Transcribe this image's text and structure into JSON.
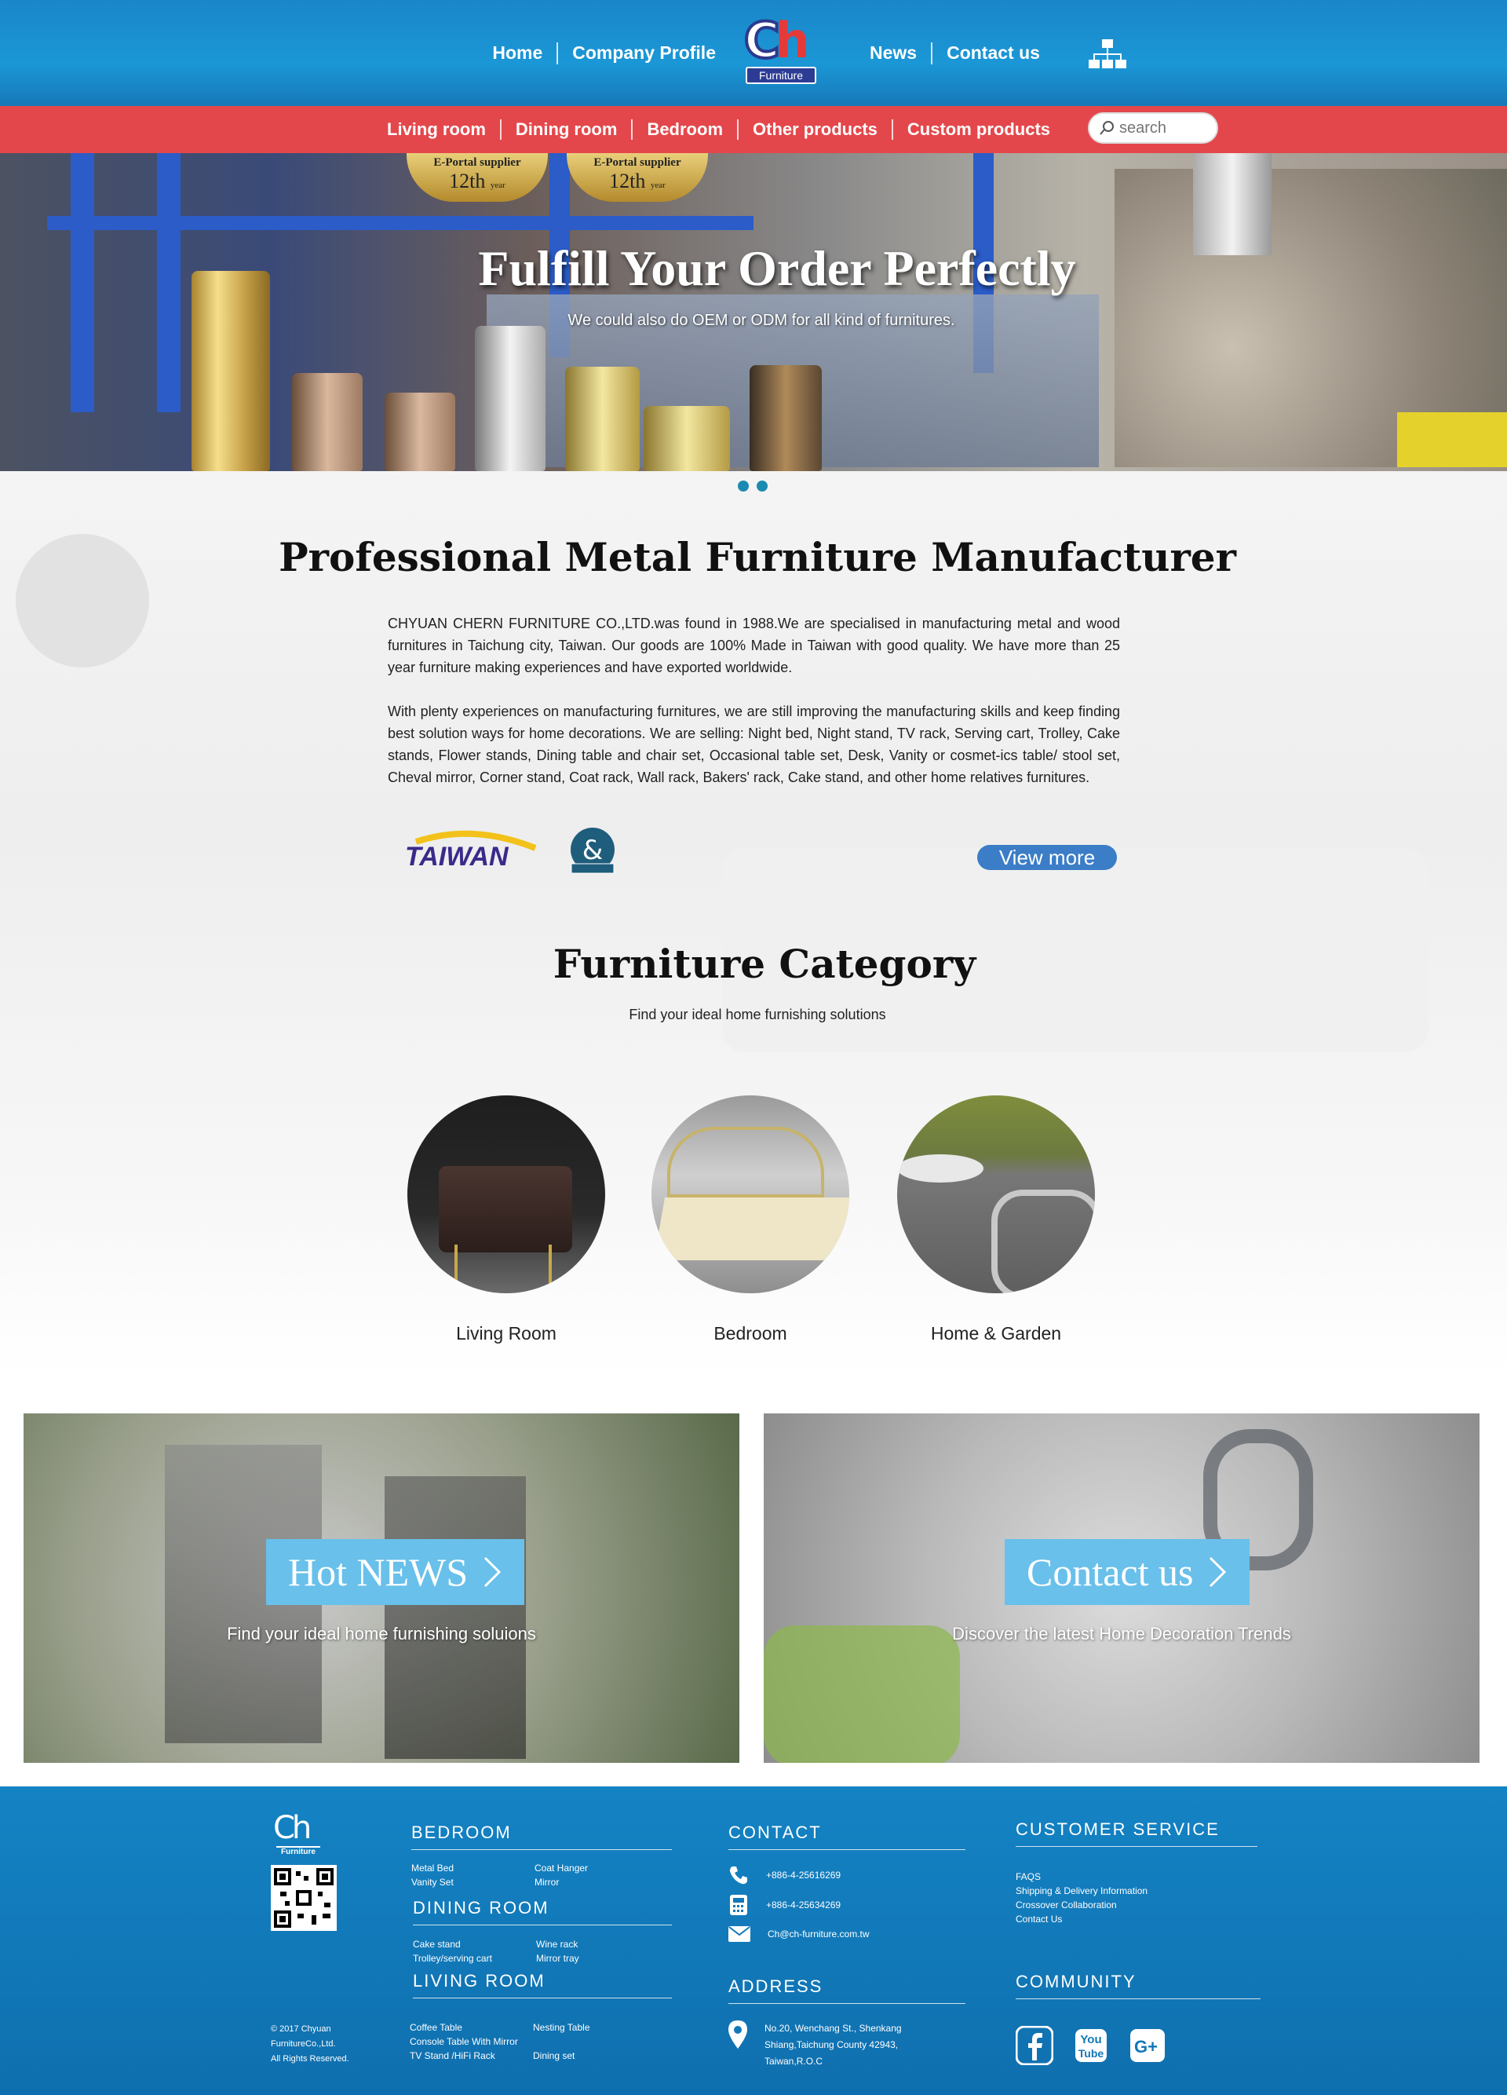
{
  "nav": {
    "left": [
      "Home",
      "Company Profile"
    ],
    "right": [
      "News",
      "Contact us"
    ],
    "logo_text": "Ch",
    "logo_sub": "Furniture"
  },
  "categories_nav": [
    "Living room",
    "Dining room",
    "Bedroom",
    "Other products",
    "Custom products"
  ],
  "search": {
    "placeholder": "search"
  },
  "hero": {
    "badge_top": "E-Portal supplier",
    "badge_num": "12th",
    "badge_year": "year",
    "title": "Fulfill Your Order Perfectly",
    "subtitle": "We could also do OEM or ODM for all kind of furnitures."
  },
  "about": {
    "title": "Professional Metal Furniture Manufacturer",
    "p1": "CHYUAN CHERN FURNITURE CO.,LTD.was found in 1988.We are specialised in manufacturing metal and wood furnitures in Taichung city, Taiwan. Our goods are 100% Made in Taiwan with good quality. We have more than 25 year furniture making experiences and have exported worldwide.",
    "p2": "With plenty experiences on manufacturing furnitures, we are still improving the manufacturing skills and keep finding best solution ways for home decorations. We are selling: Night bed, Night stand, TV rack, Serving cart, Trolley, Cake stands, Flower stands, Dining table and chair set, Occasional table set, Desk, Vanity or cosmet-ics table/ stool set, Cheval mirror, Corner stand, Coat rack, Wall rack, Bakers' rack, Cake stand, and other home relatives furnitures.",
    "taiwan_logo": "TAIWAN",
    "view_more": "View more"
  },
  "category": {
    "title": "Furniture Category",
    "subtitle": "Find your ideal home furnishing solutions",
    "items": [
      "Living Room",
      "Bedroom",
      "Home & Garden"
    ]
  },
  "panels": {
    "news_btn": "Hot NEWS",
    "news_caption": "Find your ideal home furnishing soluions",
    "contact_btn": "Contact us",
    "contact_caption": "Discover the latest Home Decoration Trends"
  },
  "footer": {
    "logo_text": "Ch",
    "logo_sub": "Furniture",
    "copyright": [
      "© 2017 Chyuan",
      "FurnitureCo.,Ltd.",
      "All Rights Reserved."
    ],
    "bedroom": {
      "title": "BEDROOM",
      "links": [
        "Metal Bed",
        "Coat Hanger",
        "Vanity Set",
        "Mirror"
      ]
    },
    "dining": {
      "title": "DINING ROOM",
      "links": [
        "Cake stand",
        "Wine rack",
        "Trolley/serving cart",
        "Mirror tray"
      ]
    },
    "living": {
      "title": "LIVING ROOM",
      "links": [
        "Coffee Table",
        "Nesting Table",
        "Console Table With Mirror",
        "",
        "TV Stand /HiFi Rack",
        "Dining set"
      ]
    },
    "contact": {
      "title": "CONTACT",
      "phone": "+886-4-25616269",
      "fax": "+886-4-25634269",
      "email": "Ch@ch-furniture.com.tw"
    },
    "address": {
      "title": "ADDRESS",
      "lines": [
        "No.20, Wenchang St., Shenkang",
        "Shiang,Taichung County 42943,",
        "Taiwan,R.O.C"
      ]
    },
    "service": {
      "title": "CUSTOMER SERVICE",
      "links": [
        "FAQS",
        "Shipping & Delivery Information",
        "Crossover Collaboration",
        "Contact Us"
      ]
    },
    "community": {
      "title": "COMMUNITY"
    }
  },
  "colors": {
    "header_blue": "#1b97d6",
    "category_red": "#e4474b",
    "footer_blue": "#1178b8",
    "button_blue": "#3b7dc6",
    "panel_button": "#69c0ea"
  }
}
